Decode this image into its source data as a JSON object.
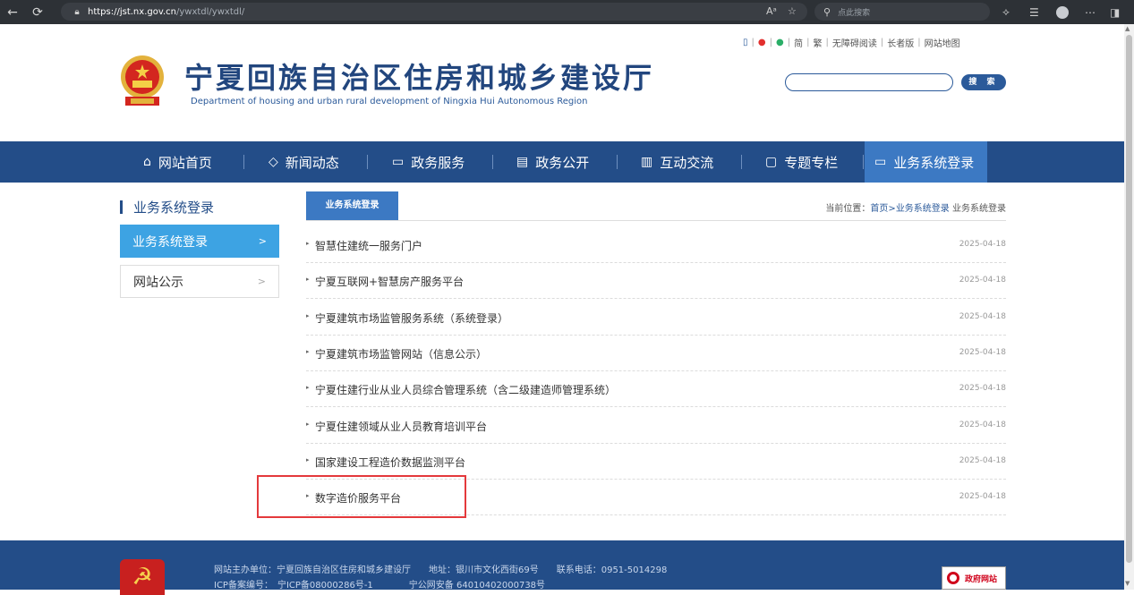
{
  "browser": {
    "back_icon": "←",
    "refresh_icon": "⟳",
    "url_host": "https://jst.nx.gov.cn",
    "url_path": "/ywxtdl/ywxtdl/",
    "search_placeholder": "点此搜索"
  },
  "top_links": {
    "simplified": "简",
    "traditional": "繁",
    "accessible": "无障碍阅读",
    "elderly": "长者版",
    "sitemap": "网站地图"
  },
  "header": {
    "title": "宁夏回族自治区住房和城乡建设厅",
    "subtitle": "Department of housing and urban rural development of Ningxia Hui Autonomous Region",
    "search_button": "搜 索"
  },
  "nav": {
    "items": [
      {
        "label": "网站首页",
        "icon": "⌂"
      },
      {
        "label": "新闻动态",
        "icon": "◇"
      },
      {
        "label": "政务服务",
        "icon": "▭"
      },
      {
        "label": "政务公开",
        "icon": "▤"
      },
      {
        "label": "互动交流",
        "icon": "▥"
      },
      {
        "label": "专题专栏",
        "icon": "▢"
      },
      {
        "label": "业务系统登录",
        "icon": "▭"
      }
    ]
  },
  "sidebar": {
    "title": "业务系统登录",
    "items": [
      {
        "label": "业务系统登录",
        "arrow": ">"
      },
      {
        "label": "网站公示",
        "arrow": ">"
      }
    ]
  },
  "content": {
    "tab_label": "业务系统登录",
    "breadcrumb_prefix": "当前位置：",
    "breadcrumb_home": "首页",
    "breadcrumb_sep": ">",
    "breadcrumb_section": "业务系统登录",
    "breadcrumb_current": " 业务系统登录",
    "items": [
      {
        "title": "智慧住建统一服务门户",
        "date": "2025-04-18"
      },
      {
        "title": "宁夏互联网+智慧房产服务平台",
        "date": "2025-04-18"
      },
      {
        "title": "宁夏建筑市场监管服务系统（系统登录）",
        "date": "2025-04-18"
      },
      {
        "title": "宁夏建筑市场监管网站（信息公示）",
        "date": "2025-04-18"
      },
      {
        "title": "宁夏住建行业从业人员综合管理系统（含二级建造师管理系统）",
        "date": "2025-04-18"
      },
      {
        "title": "宁夏住建领域从业人员教育培训平台",
        "date": "2025-04-18"
      },
      {
        "title": "国家建设工程造价数据监测平台",
        "date": "2025-04-18"
      },
      {
        "title": "数字造价服务平台",
        "date": "2025-04-18"
      }
    ]
  },
  "footer": {
    "line1": "网站主办单位：宁夏回族自治区住房和城乡建设厅　　地址：银川市文化西街69号　　联系电话：0951-5014298",
    "line2": "ICP备案编号：　宁ICP备08000286号-1　　　　宁公网安备 64010402000738号",
    "gov_badge": "政府网站"
  },
  "colors": {
    "nav_bg": "#234d88",
    "nav_active": "#3c79c3",
    "sidebar_active": "#3da3e3",
    "highlight": "#e4393c"
  }
}
